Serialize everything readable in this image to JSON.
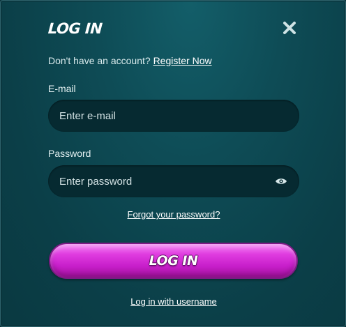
{
  "dialog": {
    "title": "LOG IN",
    "close_icon": "close-icon"
  },
  "register": {
    "prompt": "Don't have an account?",
    "link_label": "Register Now"
  },
  "email": {
    "label": "E-mail",
    "placeholder": "Enter e-mail",
    "value": ""
  },
  "password": {
    "label": "Password",
    "placeholder": "Enter password",
    "value": "",
    "toggle_icon": "eye-icon"
  },
  "forgot_link": "Forgot your password?",
  "login_button": "LOG IN",
  "alt_login_link": "Log in with username",
  "colors": {
    "background": "#0e4c56",
    "input_bg": "#062a31",
    "button_accent": "#d12cd4",
    "text": "#ffffff"
  }
}
